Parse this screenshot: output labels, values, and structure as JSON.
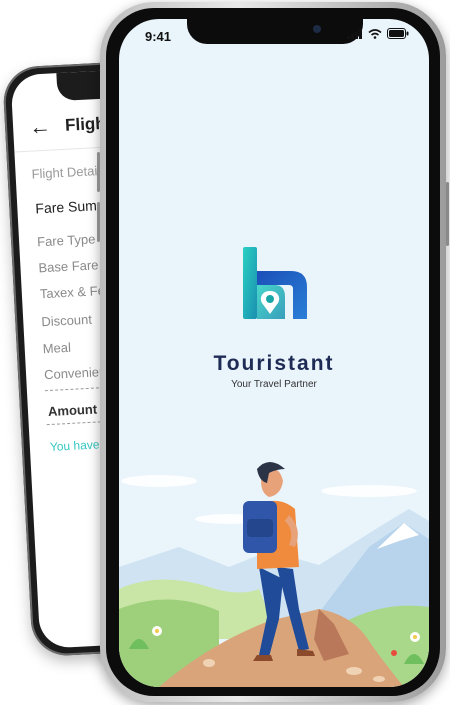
{
  "back_screen": {
    "header": {
      "back_icon": "arrow-left-icon",
      "title": "Fligh"
    },
    "tab_label": "Flight Detai",
    "section_title": "Fare Summ",
    "fare_rows": [
      "Fare Type",
      "Base Fare",
      "Taxex & Fee",
      "Discount",
      "Meal",
      "Convenienc"
    ],
    "amount_label": "Amount Pai",
    "savings_text": "You have sa"
  },
  "front_screen": {
    "status_bar": {
      "time": "9:41",
      "icons": [
        "signal-icon",
        "wifi-icon",
        "battery-icon"
      ]
    },
    "brand_name": "Touristant",
    "tagline": "Your Travel Partner",
    "colors": {
      "brand": "#1e2b55",
      "logo_teal": "#1aa6a6",
      "logo_blue": "#2a5bd7",
      "sky": "#eaf4fb"
    }
  }
}
